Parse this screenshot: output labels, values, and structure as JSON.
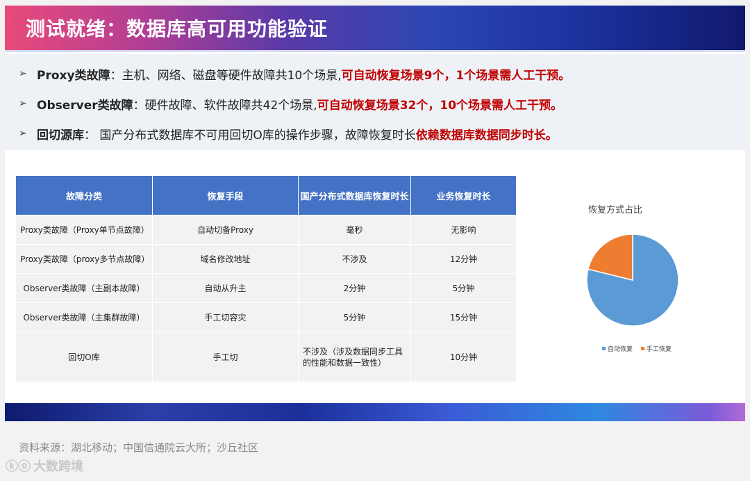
{
  "title": "测试就绪：数据库高可用功能验证",
  "bullets": [
    {
      "head": "Proxy类故障",
      "text": "：主机、网络、磁盘等硬件故障共10个场景,",
      "red": "可自动恢复场景9个，1个场景需人工干预。"
    },
    {
      "head": "Observer类故障",
      "text": "：硬件故障、软件故障共42个场景,",
      "red": "可自动恢复场景32个，10个场景需人工干预。"
    },
    {
      "head": "回切源库",
      "text": " ： 国产分布式数据库不可用回切O库的操作步骤，故障恢复时长",
      "red": "依赖数据库数据同步时长。"
    }
  ],
  "table": {
    "headers": [
      "故障分类",
      "恢复手段",
      "国产分布式数据库恢复时长",
      "业务恢复时长"
    ],
    "rows": [
      [
        "Proxy类故障（Proxy单节点故障）",
        "自动切备Proxy",
        "毫秒",
        "无影响"
      ],
      [
        "Proxy类故障（proxy多节点故障）",
        "域名修改地址",
        "不涉及",
        "12分钟"
      ],
      [
        "Observer类故障（主副本故障）",
        "自动从升主",
        "2分钟",
        "5分钟"
      ],
      [
        "Observer类故障（主集群故障）",
        "手工切容灾",
        "5分钟",
        "15分钟"
      ],
      [
        "回切O库",
        "手工切",
        "不涉及（涉及数据同步工具的性能和数据一致性）",
        "10分钟"
      ]
    ]
  },
  "chart_data": {
    "type": "pie",
    "title": "恢复方式占比",
    "labels": [
      "自动恢复",
      "手工恢复"
    ],
    "values": [
      41,
      11
    ],
    "colors": [
      "#5b9bd5",
      "#ed7d31"
    ],
    "legend_position": "bottom"
  },
  "source_text": "资料来源：湖北移动；中国信通院云大所；沙丘社区",
  "logo_text": "大数跨境",
  "logo_mark": "ⓚⓞ"
}
